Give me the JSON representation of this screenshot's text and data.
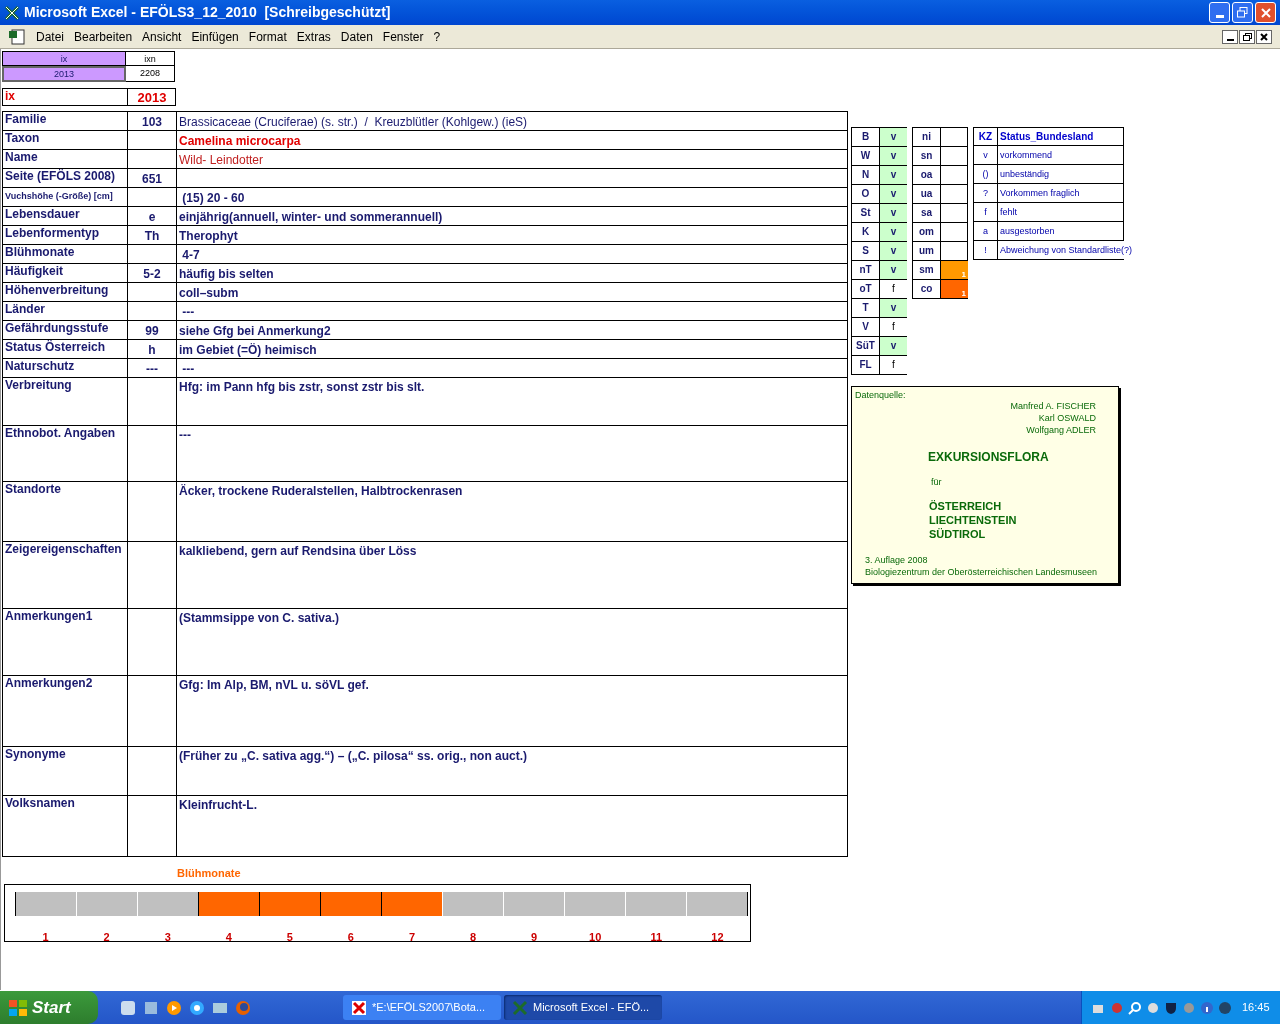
{
  "window": {
    "title": "Microsoft Excel - EFÖLS3_12_2010  [Schreibgeschützt]"
  },
  "menu": [
    "Datei",
    "Bearbeiten",
    "Ansicht",
    "Einfügen",
    "Format",
    "Extras",
    "Daten",
    "Fenster",
    "?"
  ],
  "index_cells": {
    "ix_label": "ix",
    "ixn_label": "ixn",
    "ix_value": "2013",
    "ixn_value": "2208"
  },
  "ix_row": {
    "label": "ix",
    "value": "2013"
  },
  "rows": [
    {
      "label": "Familie",
      "code": "103",
      "value": "Brassicaceae (Cruciferae) (s. str.)  /  Kreuzblütler (Kohlgew.) (ieS)",
      "kind": "normal"
    },
    {
      "label": "Taxon",
      "value": "Camelina microcarpa",
      "kind": "taxon"
    },
    {
      "label": "Name",
      "value": "Wild- Leindotter",
      "kind": "name"
    },
    {
      "label": "Seite (EFÖLS 2008)",
      "code": "651",
      "kind": "bold"
    },
    {
      "label": "**Vuchshöhe** (-Größe) [cm]",
      "value": " (15) 20 - 60",
      "kind": "small-label"
    },
    {
      "label": "Lebensdauer",
      "code": "e",
      "value": "einjährig(annuell, winter- und sommerannuell)",
      "kind": "bold"
    },
    {
      "label": "Lebenformentyp",
      "code": "Th",
      "value": "Therophyt",
      "kind": "bold"
    },
    {
      "label": "Blühmonate",
      "value": " 4-7",
      "kind": "bold"
    },
    {
      "label": "Häufigkeit",
      "code": "5-2",
      "value": "häufig bis selten",
      "kind": "bold"
    },
    {
      "label": "Höhenverbreitung",
      "value": "coll–subm",
      "kind": "bold"
    },
    {
      "label": "Länder",
      "value": " ---",
      "kind": "bold"
    },
    {
      "label": "Gefährdungsstufe",
      "code": "99",
      "value": "siehe Gfg bei Anmerkung2",
      "kind": "bold"
    },
    {
      "label": "Status Österreich",
      "code": "h",
      "value": "im Gebiet (=Ö) heimisch",
      "kind": "bold"
    },
    {
      "label": "Naturschutz",
      "code": "---",
      "value": " ---",
      "kind": "bold"
    },
    {
      "label": "Verbreitung",
      "value": "Hfg: im Pann hfg bis zstr, sonst zstr bis slt.",
      "kind": "long"
    },
    {
      "label": "Ethnobot. Angaben",
      "value": "---",
      "kind": "long"
    },
    {
      "label": "Standorte",
      "value": "Äcker, trockene Ruderalstellen, Halbtrockenrasen",
      "kind": "long"
    },
    {
      "label": "Zeigereigenschaften",
      "value": "kalkliebend, gern auf Rendsina über Löss",
      "kind": "long"
    },
    {
      "label": "Anmerkungen1",
      "value": "(Stammsippe von C. sativa.)",
      "kind": "long"
    },
    {
      "label": "Anmerkungen2",
      "value": "Gfg: Im Alp, BM, nVL u. söVL gef.",
      "kind": "long"
    },
    {
      "label": "Synonyme",
      "value": "(Früher zu „C. sativa agg.“) – („C. pilosa“ ss. orig., non auct.)",
      "kind": "long"
    },
    {
      "label": "Volksnamen",
      "value": "Kleinfrucht-L.",
      "kind": "long"
    }
  ],
  "regions": [
    {
      "code": "B",
      "status": "v",
      "present": true
    },
    {
      "code": "W",
      "status": "v",
      "present": true
    },
    {
      "code": "N",
      "status": "v",
      "present": true
    },
    {
      "code": "O",
      "status": "v",
      "present": true
    },
    {
      "code": "St",
      "status": "v",
      "present": true
    },
    {
      "code": "K",
      "status": "v",
      "present": true
    },
    {
      "code": "S",
      "status": "v",
      "present": true
    },
    {
      "code": "nT",
      "status": "v",
      "present": true
    },
    {
      "code": "oT",
      "status": "f",
      "present": false
    },
    {
      "code": "T",
      "status": "v",
      "present": true
    },
    {
      "code": "V",
      "status": "f",
      "present": false
    },
    {
      "code": "SüT",
      "status": "v",
      "present": true
    },
    {
      "code": "FL",
      "status": "f",
      "present": false
    }
  ],
  "altitudes": [
    {
      "code": "ni"
    },
    {
      "code": "sn"
    },
    {
      "code": "oa"
    },
    {
      "code": "ua"
    },
    {
      "code": "sa"
    },
    {
      "code": "om"
    },
    {
      "code": "um"
    },
    {
      "code": "sm",
      "value": "1",
      "color": "#ff9900"
    },
    {
      "code": "co",
      "value": "1",
      "color": "#ff6600"
    }
  ],
  "legend": {
    "header": {
      "kz": "KZ",
      "title": "Status_Bundesland"
    },
    "rows": [
      {
        "kz": "v",
        "text": "vorkommend"
      },
      {
        "kz": "()",
        "text": "unbeständig"
      },
      {
        "kz": "?",
        "text": "Vorkommen fraglich"
      },
      {
        "kz": "f",
        "text": "fehlt"
      },
      {
        "kz": "a",
        "text": "ausgestorben"
      },
      {
        "kz": "!",
        "text": "Abweichung von Standardliste(?)"
      }
    ]
  },
  "source": {
    "caption": "Datenquelle:",
    "authors": [
      "Manfred A. FISCHER",
      "Karl OSWALD",
      "Wolfgang ADLER"
    ],
    "title": "EXKURSIONSFLORA",
    "for": "für",
    "countries": [
      "ÖSTERREICH",
      "LIECHTENSTEIN",
      "SÜDTIROL"
    ],
    "edition": "3. Auflage 2008",
    "publisher": "Biologiezentrum der Oberösterreichischen Landesmuseen"
  },
  "bloom": {
    "title": "Blühmonate",
    "months": [
      {
        "label": "1",
        "selected": false
      },
      {
        "label": "2",
        "selected": false
      },
      {
        "label": "3",
        "selected": false
      },
      {
        "label": "4",
        "selected": true
      },
      {
        "label": "5",
        "selected": true
      },
      {
        "label": "6",
        "selected": true
      },
      {
        "label": "7",
        "selected": true
      },
      {
        "label": "8",
        "selected": false
      },
      {
        "label": "9",
        "selected": false
      },
      {
        "label": "10",
        "selected": false
      },
      {
        "label": "11",
        "selected": false
      },
      {
        "label": "12",
        "selected": false
      }
    ]
  },
  "taskbar": {
    "start": "Start",
    "tasks": [
      {
        "label": "*E:\\EFÖLS2007\\Bota...",
        "selected": false
      },
      {
        "label": "Microsoft Excel - EFÖ...",
        "selected": true
      }
    ],
    "clock": "16:45"
  }
}
